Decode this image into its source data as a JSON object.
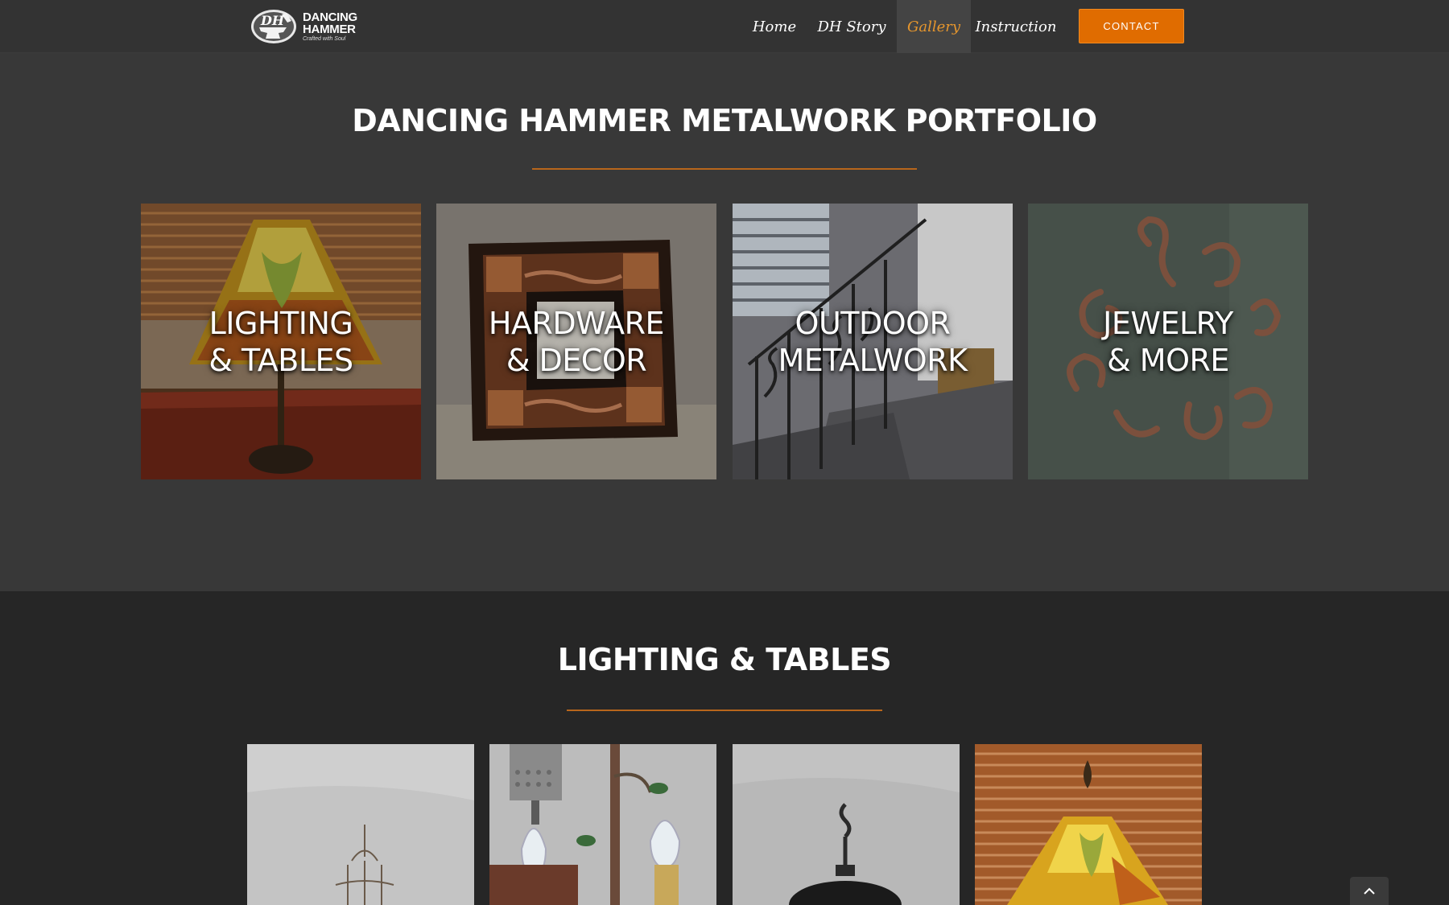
{
  "logo": {
    "line1": "DANCING",
    "line2": "HAMMER",
    "tagline": "Crafted with Soul"
  },
  "nav": {
    "home": "Home",
    "story": "DH Story",
    "gallery": "Gallery",
    "instruction": "Instruction",
    "contact": "CONTACT"
  },
  "portfolio": {
    "title": "DANCING HAMMER METALWORK PORTFOLIO",
    "tiles": [
      {
        "line1": "LIGHTING",
        "line2": "& TABLES"
      },
      {
        "line1": "HARDWARE",
        "line2": "& DECOR"
      },
      {
        "line1": "OUTDOOR",
        "line2": "METALWORK"
      },
      {
        "line1": "JEWELRY",
        "line2": "& MORE"
      }
    ]
  },
  "lighting": {
    "title": "LIGHTING & TABLES"
  },
  "colors": {
    "accent": "#e06c00",
    "active_nav": "#e6962d",
    "rule": "#b8661c",
    "header_bg": "#333333",
    "section_bg": "#383838",
    "page_bg": "#262626"
  },
  "icons": {
    "back_to_top": "chevron-up-icon"
  }
}
